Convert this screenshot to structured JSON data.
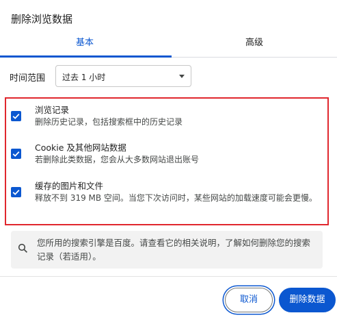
{
  "dialog": {
    "title": "删除浏览数据"
  },
  "tabs": [
    {
      "label": "基本",
      "selected": true
    },
    {
      "label": "高级",
      "selected": false
    }
  ],
  "time_range": {
    "label": "时间范围",
    "value": "过去 1 小时"
  },
  "options": [
    {
      "title": "浏览记录",
      "description": "删除历史记录，包括搜索框中的历史记录",
      "checked": true
    },
    {
      "title": "Cookie 及其他网站数据",
      "description": "若删除此类数据，您会从大多数网站退出账号",
      "checked": true
    },
    {
      "title": "缓存的图片和文件",
      "description": "释放不到 319 MB 空间。当您下次访问时，某些网站的加载速度可能会更慢。",
      "checked": true
    }
  ],
  "info": {
    "icon": "search-icon",
    "text": "您所用的搜索引擎是百度。请查看它的相关说明，了解如何删除您的搜索记录（若适用）。"
  },
  "buttons": {
    "cancel_label": "取消",
    "delete_label": "删除数据"
  },
  "colors": {
    "accent": "#0b57d0",
    "highlight_border": "#e0262d"
  }
}
